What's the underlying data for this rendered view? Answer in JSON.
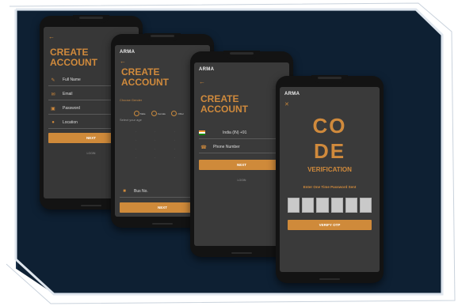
{
  "colors": {
    "accent": "#cf8a3a",
    "background": "#0e2033",
    "screen": "#3a3a3a"
  },
  "phone1": {
    "back_icon": "arrow-left",
    "title_line1": "CREATE",
    "title_line2": "ACCOUNT",
    "fields": [
      {
        "icon": "edit-icon",
        "label": "Full Name"
      },
      {
        "icon": "mail-icon",
        "label": "Email"
      },
      {
        "icon": "lock-icon",
        "label": "Password"
      },
      {
        "icon": "person-icon",
        "label": "Location"
      }
    ],
    "next_label": "NEXT",
    "footer_text": "LOGIN"
  },
  "phone2": {
    "brand": "ARMA",
    "title_line1": "CREATE",
    "title_line2": "ACCOUNT",
    "gender_label": "Choose Gender",
    "gender_options": [
      "Male",
      "Female",
      "Other"
    ],
    "age_label": "Select your age",
    "bus_label": "Bus No.",
    "next_label": "NEXT"
  },
  "phone3": {
    "brand": "ARMA",
    "title_line1": "CREATE",
    "title_line2": "ACCOUNT",
    "country_value": "India (IN) +91",
    "phone_placeholder": "Phone Number",
    "next_label": "NEXT",
    "footer_text": "LOGIN"
  },
  "phone4": {
    "brand": "ARMA",
    "close_icon": "x",
    "code_line1": "CO",
    "code_line2": "DE",
    "verification_label": "VERIFICATION",
    "otp_prompt": "Enter One Time Password Sent",
    "otp_box_count": 6,
    "verify_label": "VERIFY OTP"
  }
}
